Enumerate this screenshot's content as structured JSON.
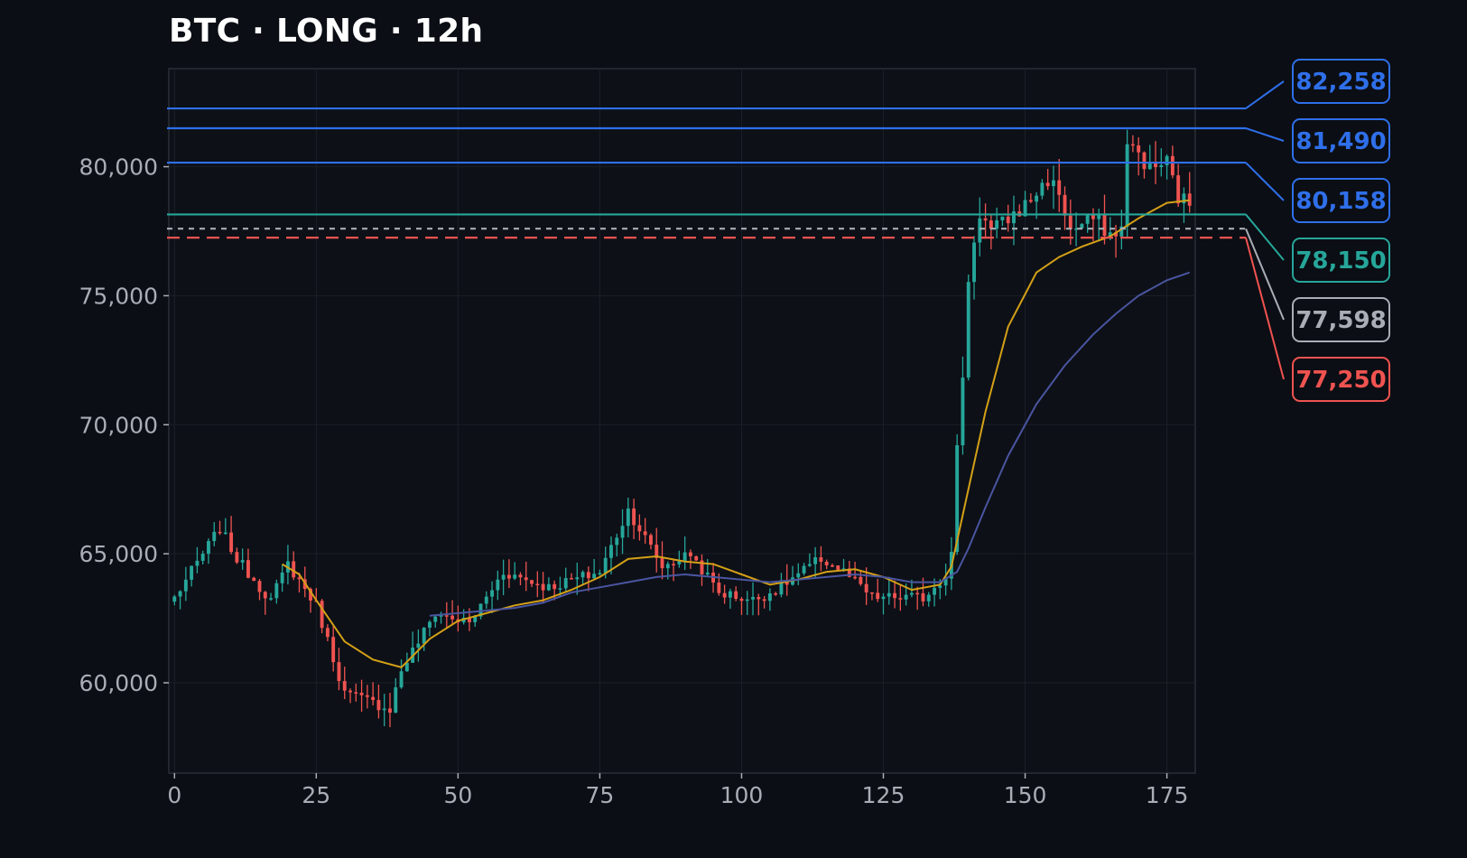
{
  "chart_data": {
    "type": "candlestick",
    "title": "BTC · LONG · 12h",
    "xlabel": "",
    "ylabel": "",
    "xlim": [
      -1,
      180
    ],
    "ylim": [
      56500,
      83800
    ],
    "x_ticks": [
      0,
      25,
      50,
      75,
      100,
      125,
      150,
      175
    ],
    "y_ticks": [
      60000,
      65000,
      70000,
      75000,
      80000
    ],
    "grid": true,
    "legend": "none",
    "candle_colors": {
      "up": "#26a69a",
      "down": "#ef5350"
    },
    "close_anchors": [
      [
        0,
        63300
      ],
      [
        8,
        66000
      ],
      [
        11,
        64800
      ],
      [
        17,
        63200
      ],
      [
        20,
        64600
      ],
      [
        25,
        63000
      ],
      [
        30,
        59600
      ],
      [
        38,
        59000
      ],
      [
        40,
        60500
      ],
      [
        46,
        62700
      ],
      [
        52,
        62300
      ],
      [
        58,
        64300
      ],
      [
        66,
        63700
      ],
      [
        75,
        64300
      ],
      [
        80,
        66700
      ],
      [
        86,
        64500
      ],
      [
        91,
        65000
      ],
      [
        96,
        63500
      ],
      [
        102,
        63200
      ],
      [
        106,
        63600
      ],
      [
        114,
        64800
      ],
      [
        118,
        64300
      ],
      [
        123,
        63300
      ],
      [
        132,
        63300
      ],
      [
        136,
        64200
      ],
      [
        137,
        65000
      ],
      [
        138,
        69000
      ],
      [
        139,
        72000
      ],
      [
        140,
        75500
      ],
      [
        141,
        77200
      ],
      [
        142,
        78200
      ],
      [
        144,
        77500
      ],
      [
        146,
        77800
      ],
      [
        150,
        78500
      ],
      [
        154,
        79500
      ],
      [
        156,
        79000
      ],
      [
        158,
        77500
      ],
      [
        162,
        78000
      ],
      [
        166,
        77200
      ],
      [
        167,
        77900
      ],
      [
        168,
        80800
      ],
      [
        170,
        80500
      ],
      [
        172,
        79900
      ],
      [
        175,
        80200
      ],
      [
        177,
        78800
      ],
      [
        179,
        78600
      ]
    ],
    "series": [
      {
        "name": "",
        "color": "#d4a017",
        "points": [
          [
            19,
            64600
          ],
          [
            22,
            64200
          ],
          [
            25,
            63200
          ],
          [
            30,
            61600
          ],
          [
            35,
            60900
          ],
          [
            40,
            60600
          ],
          [
            45,
            61700
          ],
          [
            50,
            62400
          ],
          [
            55,
            62700
          ],
          [
            60,
            63000
          ],
          [
            65,
            63200
          ],
          [
            70,
            63600
          ],
          [
            75,
            64100
          ],
          [
            80,
            64800
          ],
          [
            85,
            64900
          ],
          [
            90,
            64700
          ],
          [
            95,
            64600
          ],
          [
            100,
            64200
          ],
          [
            105,
            63800
          ],
          [
            110,
            64000
          ],
          [
            115,
            64300
          ],
          [
            120,
            64400
          ],
          [
            125,
            64100
          ],
          [
            130,
            63600
          ],
          [
            135,
            63800
          ],
          [
            137,
            64500
          ],
          [
            140,
            67500
          ],
          [
            143,
            70500
          ],
          [
            147,
            73800
          ],
          [
            152,
            75900
          ],
          [
            156,
            76500
          ],
          [
            160,
            76900
          ],
          [
            165,
            77300
          ],
          [
            170,
            78000
          ],
          [
            175,
            78600
          ],
          [
            179,
            78700
          ]
        ]
      },
      {
        "name": "",
        "color": "#4a55a0",
        "points": [
          [
            45,
            62600
          ],
          [
            50,
            62700
          ],
          [
            60,
            62900
          ],
          [
            65,
            63100
          ],
          [
            70,
            63500
          ],
          [
            75,
            63700
          ],
          [
            80,
            63900
          ],
          [
            85,
            64100
          ],
          [
            90,
            64200
          ],
          [
            95,
            64100
          ],
          [
            100,
            64000
          ],
          [
            105,
            63900
          ],
          [
            110,
            64000
          ],
          [
            115,
            64100
          ],
          [
            120,
            64200
          ],
          [
            125,
            64100
          ],
          [
            130,
            63900
          ],
          [
            135,
            63900
          ],
          [
            138,
            64300
          ],
          [
            140,
            65200
          ],
          [
            143,
            66800
          ],
          [
            147,
            68800
          ],
          [
            152,
            70800
          ],
          [
            157,
            72300
          ],
          [
            162,
            73500
          ],
          [
            166,
            74300
          ],
          [
            170,
            75000
          ],
          [
            175,
            75600
          ],
          [
            179,
            75900
          ]
        ]
      }
    ],
    "levels": [
      {
        "label": "82,258",
        "value": 82258,
        "color": "#2f6fea",
        "dash": ""
      },
      {
        "label": "81,490",
        "value": 81490,
        "color": "#2f6fea",
        "dash": ""
      },
      {
        "label": "80,158",
        "value": 80158,
        "color": "#2f6fea",
        "dash": ""
      },
      {
        "label": "78,150",
        "value": 78150,
        "color": "#26a69a",
        "dash": ""
      },
      {
        "label": "77,598",
        "value": 77598,
        "color": "#a9adb5",
        "dash": "6,6"
      },
      {
        "label": "77,250",
        "value": 77250,
        "color": "#ef5350",
        "dash": "14,8"
      }
    ]
  }
}
